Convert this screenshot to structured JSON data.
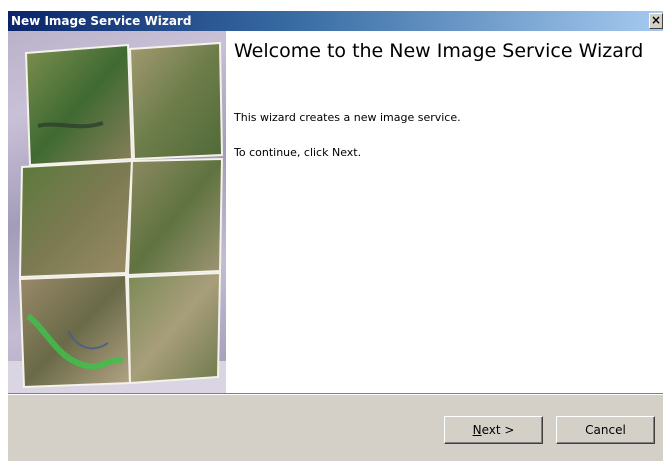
{
  "window": {
    "title": "New Image Service Wizard",
    "close_glyph": "×"
  },
  "welcome": {
    "heading": "Welcome to the New Image Service Wizard",
    "description": "This wizard creates a new image service.",
    "instruction": "To continue, click Next."
  },
  "buttons": {
    "next_mnemonic": "N",
    "next_rest": "ext >",
    "cancel": "Cancel"
  },
  "side_image": {
    "icon": "satellite-imagery-mosaic"
  },
  "colors": {
    "title_bar_start": "#0a246a",
    "title_bar_end": "#a6caf0",
    "dialog_face": "#d4d0c8"
  }
}
